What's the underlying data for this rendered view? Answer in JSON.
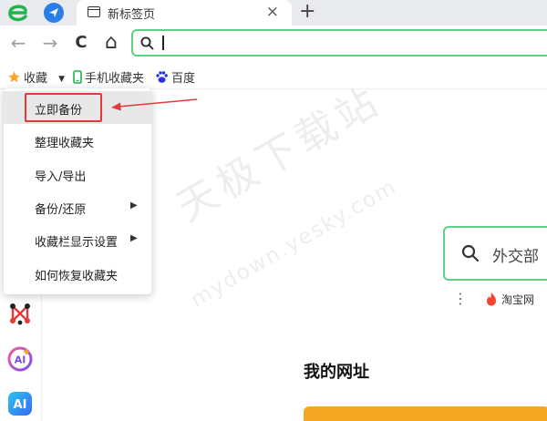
{
  "tab": {
    "title": "新标签页",
    "close": "×",
    "new_tab": "+"
  },
  "toolbar": {
    "back": "←",
    "forward": "→",
    "reload": "C",
    "home": "⌂",
    "address_value": ""
  },
  "bookmarks_bar": {
    "favorites_label": "收藏",
    "mobile_label": "手机收藏夹",
    "baidu_label": "百度"
  },
  "menu": {
    "items": [
      {
        "label": "立即备份",
        "submenu": false
      },
      {
        "label": "整理收藏夹",
        "submenu": false
      },
      {
        "label": "导入/导出",
        "submenu": false
      },
      {
        "label": "备份/还原",
        "submenu": true,
        "arrow": "▶"
      },
      {
        "label": "收藏栏显示设置",
        "submenu": true,
        "arrow": "▶"
      },
      {
        "label": "如何恢复收藏夹",
        "submenu": false
      }
    ]
  },
  "watermark": {
    "text": "天极下载站",
    "url": "mydown.yesky.com"
  },
  "page": {
    "search_placeholder": "外交部",
    "kebab": "⋮",
    "quick_link": "淘宝网",
    "sites_title": "我的网址"
  },
  "colors": {
    "accent": "#5ecf83",
    "highlight_red": "#e5383b",
    "brand_blue": "#2b7de9",
    "banner_orange": "#f5a623"
  },
  "icons": {
    "logo": "browser-logo-icon",
    "star": "star-icon",
    "phone": "phone-icon",
    "baidu": "baidu-paw-icon",
    "sidebar": [
      "network-app-icon",
      "ai-assistant-icon",
      "ai-app-icon"
    ]
  }
}
